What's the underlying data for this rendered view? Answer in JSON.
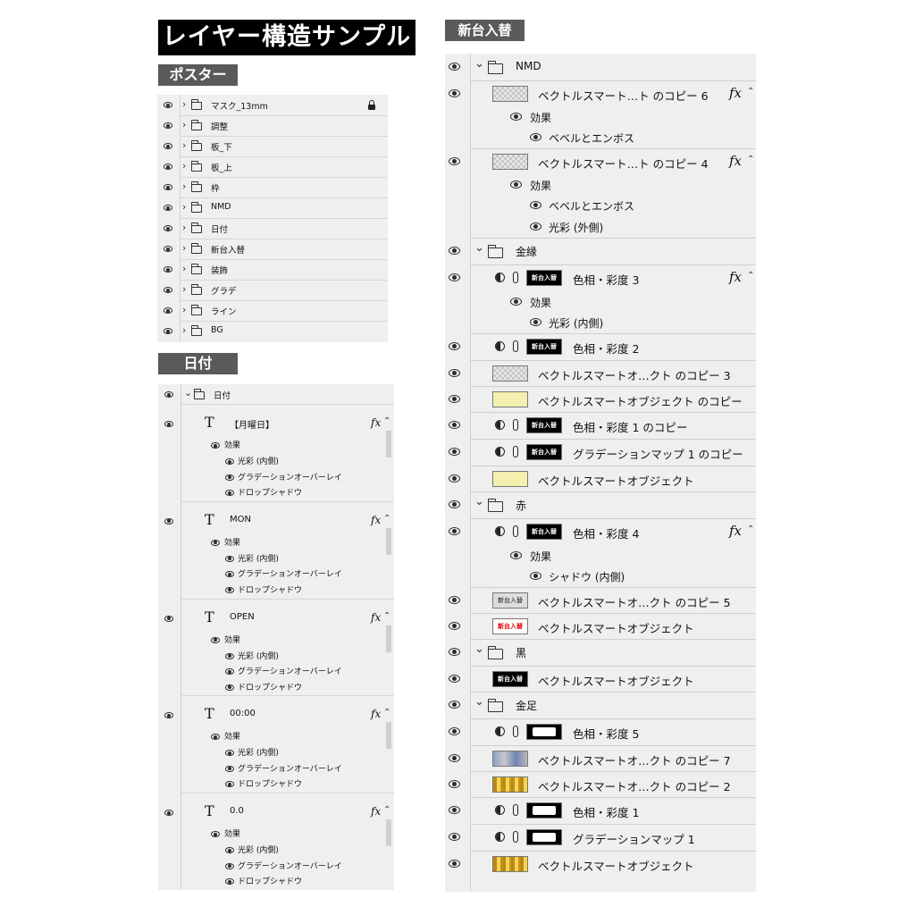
{
  "title": "レイヤー構造サンプル",
  "sections": {
    "poster": "ポスター",
    "date": "日付",
    "shindai": "新台入替"
  },
  "poster_layers": [
    {
      "name": "マスク_13mm",
      "locked": true
    },
    {
      "name": "調整"
    },
    {
      "name": "板_下"
    },
    {
      "name": "板_上"
    },
    {
      "name": "枠"
    },
    {
      "name": "NMD"
    },
    {
      "name": "日付"
    },
    {
      "name": "新台入替"
    },
    {
      "name": "装飾"
    },
    {
      "name": "グラデ"
    },
    {
      "name": "ライン"
    },
    {
      "name": "BG"
    }
  ],
  "date_panel": {
    "group": "日付",
    "effects_label": "効果",
    "fx_label": "fx",
    "layers": [
      {
        "icon": "T",
        "name": "【月曜日】",
        "effects": [
          "光彩 (内側)",
          "グラデーションオーバーレイ",
          "ドロップシャドウ"
        ]
      },
      {
        "icon": "T",
        "name": "MON",
        "effects": [
          "光彩 (内側)",
          "グラデーションオーバーレイ",
          "ドロップシャドウ"
        ]
      },
      {
        "icon": "T",
        "name": "OPEN",
        "effects": [
          "光彩 (内側)",
          "グラデーションオーバーレイ",
          "ドロップシャドウ"
        ]
      },
      {
        "icon": "T",
        "name": "00:00",
        "effects": [
          "光彩 (内側)",
          "グラデーションオーバーレイ",
          "ドロップシャドウ"
        ]
      },
      {
        "icon": "T",
        "name": "0.0",
        "effects": [
          "光彩 (内側)",
          "グラデーションオーバーレイ",
          "ドロップシャドウ"
        ]
      }
    ]
  },
  "shindai_panel": {
    "fx_label": "fx",
    "effects_label": "効果",
    "rows": [
      {
        "type": "group",
        "name": "NMD"
      },
      {
        "type": "smart",
        "name": "ベクトルスマート…ト のコピー 6",
        "thumb": "checker",
        "fx": true
      },
      {
        "type": "effects",
        "label": "効果"
      },
      {
        "type": "effect",
        "name": "ベベルとエンボス"
      },
      {
        "type": "smart",
        "name": "ベクトルスマート…ト のコピー 4",
        "thumb": "checker",
        "fx": true
      },
      {
        "type": "effects",
        "label": "効果"
      },
      {
        "type": "effect",
        "name": "ベベルとエンボス"
      },
      {
        "type": "effect",
        "name": "光彩 (外側)"
      },
      {
        "type": "group",
        "name": "金縁"
      },
      {
        "type": "adjust",
        "name": "色相・彩度 3",
        "thumb": "black",
        "thumb_text": "新台入替",
        "fx": true
      },
      {
        "type": "effects",
        "label": "効果"
      },
      {
        "type": "effect",
        "name": "光彩 (内側)"
      },
      {
        "type": "adjust",
        "name": "色相・彩度 2",
        "thumb": "black",
        "thumb_text": "新台入替"
      },
      {
        "type": "smart",
        "name": "ベクトルスマートオ…クト のコピー 3",
        "thumb": "checker"
      },
      {
        "type": "smart",
        "name": "ベクトルスマートオブジェクト のコピー",
        "thumb": "yellow"
      },
      {
        "type": "adjust",
        "name": "色相・彩度 1 のコピー",
        "thumb": "black",
        "thumb_text": "新台入替"
      },
      {
        "type": "adjust",
        "name": "グラデーションマップ 1 のコピー",
        "thumb": "black",
        "thumb_text": "新台入替"
      },
      {
        "type": "smart",
        "name": "ベクトルスマートオブジェクト",
        "thumb": "yellow"
      },
      {
        "type": "group",
        "name": "赤"
      },
      {
        "type": "adjust",
        "name": "色相・彩度 4",
        "thumb": "black",
        "thumb_text": "新台入替",
        "fx": true
      },
      {
        "type": "effects",
        "label": "効果"
      },
      {
        "type": "effect",
        "name": "シャドウ (内側)"
      },
      {
        "type": "smart",
        "name": "ベクトルスマートオ…クト のコピー 5",
        "thumb": "frame",
        "thumb_text": "新台入替"
      },
      {
        "type": "smart",
        "name": "ベクトルスマートオブジェクト",
        "thumb": "red",
        "thumb_text": "新台入替"
      },
      {
        "type": "group",
        "name": "黒"
      },
      {
        "type": "smart",
        "name": "ベクトルスマートオブジェクト",
        "thumb": "black",
        "thumb_text": "新台入替"
      },
      {
        "type": "group",
        "name": "金足"
      },
      {
        "type": "adjust",
        "name": "色相・彩度 5",
        "thumb": "blackwhite"
      },
      {
        "type": "smart",
        "name": "ベクトルスマートオ…クト のコピー 7",
        "thumb": "blue"
      },
      {
        "type": "smart",
        "name": "ベクトルスマートオ…クト のコピー 2",
        "thumb": "gold"
      },
      {
        "type": "adjust",
        "name": "色相・彩度 1",
        "thumb": "blackwhite"
      },
      {
        "type": "adjust",
        "name": "グラデーションマップ 1",
        "thumb": "blackwhite"
      },
      {
        "type": "smart",
        "name": "ベクトルスマートオブジェクト",
        "thumb": "gold"
      }
    ]
  },
  "colors": {
    "panel_bg": "#efefef",
    "tag_bg": "#5a5a5a",
    "title_bg": "#000000"
  }
}
